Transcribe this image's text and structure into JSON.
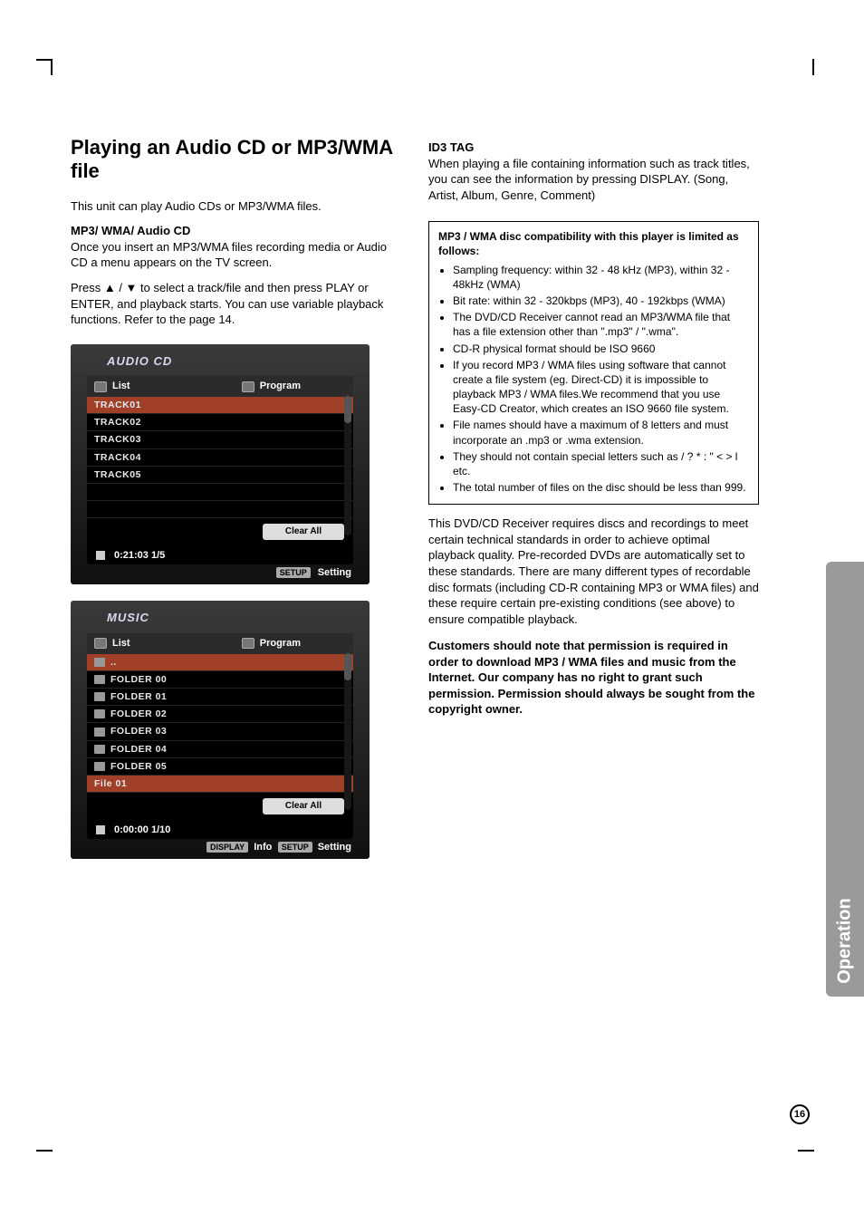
{
  "sidebar_label": "Operation",
  "page_number": "16",
  "left": {
    "h1": "Playing an Audio CD or MP3/WMA file",
    "intro": "This unit can play Audio CDs or MP3/WMA files.",
    "sub1_head": "MP3/ WMA/ Audio CD",
    "sub1_p1": "Once you insert an MP3/WMA files recording media or Audio CD  a menu appears on the TV screen.",
    "sub1_p2": "Press ▲ / ▼ to select a track/file and then press PLAY or ENTER, and playback starts. You can use variable playback functions. Refer to the page 14."
  },
  "panel1": {
    "title": "AUDIO CD",
    "col_left": "List",
    "col_right": "Program",
    "rows": [
      "TRACK01",
      "TRACK02",
      "TRACK03",
      "TRACK04",
      "TRACK05"
    ],
    "clear": "Clear All",
    "status": "0:21:03  1/5",
    "setting_tag": "SETUP",
    "setting": "Setting"
  },
  "panel2": {
    "title": "MUSIC",
    "col_left": "List",
    "col_right": "Program",
    "rows": [
      "..",
      "FOLDER  00",
      "FOLDER  01",
      "FOLDER  02",
      "FOLDER  03",
      "FOLDER  04",
      "FOLDER  05",
      "File  01"
    ],
    "clear": "Clear All",
    "status": "0:00:00  1/10",
    "info_tag": "DISPLAY",
    "info": "Info",
    "setting_tag": "SETUP",
    "setting": "Setting"
  },
  "right": {
    "id3_head": "ID3 TAG",
    "id3_body": "When playing a file containing information such as track titles, you can see the information by pressing DISPLAY. (Song, Artist, Album, Genre, Comment)",
    "note_head": "MP3 / WMA disc compatibility with this player is limited as follows:",
    "notes": [
      "Sampling frequency: within 32 - 48 kHz (MP3), within 32 - 48kHz (WMA)",
      "Bit rate: within 32 - 320kbps (MP3), 40 - 192kbps (WMA)",
      "The DVD/CD Receiver cannot read an MP3/WMA file that has a file extension other than \".mp3\" / \".wma\".",
      "CD-R physical format should be ISO 9660",
      "If you record MP3 / WMA files using software that cannot create a file system (eg. Direct-CD) it is impossible to playback MP3 / WMA files.We recommend that you use Easy-CD Creator, which creates an ISO 9660 file system.",
      "File names should have a maximum of 8 letters and must incorporate an .mp3 or .wma extension.",
      "They should not contain special letters such as  / ? * : \" < > l etc.",
      "The total number of files on the disc should be less than 999."
    ],
    "closing1": "This DVD/CD Receiver requires discs and recordings to meet certain technical standards in order to achieve optimal playback quality. Pre-recorded DVDs are automatically set to these standards. There are many different types of recordable disc formats (including CD-R containing MP3 or WMA files) and these require certain pre-existing conditions (see above) to ensure compatible playback.",
    "closing2": "Customers should note that permission is required in order to download MP3 / WMA files and music from the Internet. Our company has no right to grant such permission. Permission should always be sought from the copyright owner."
  }
}
